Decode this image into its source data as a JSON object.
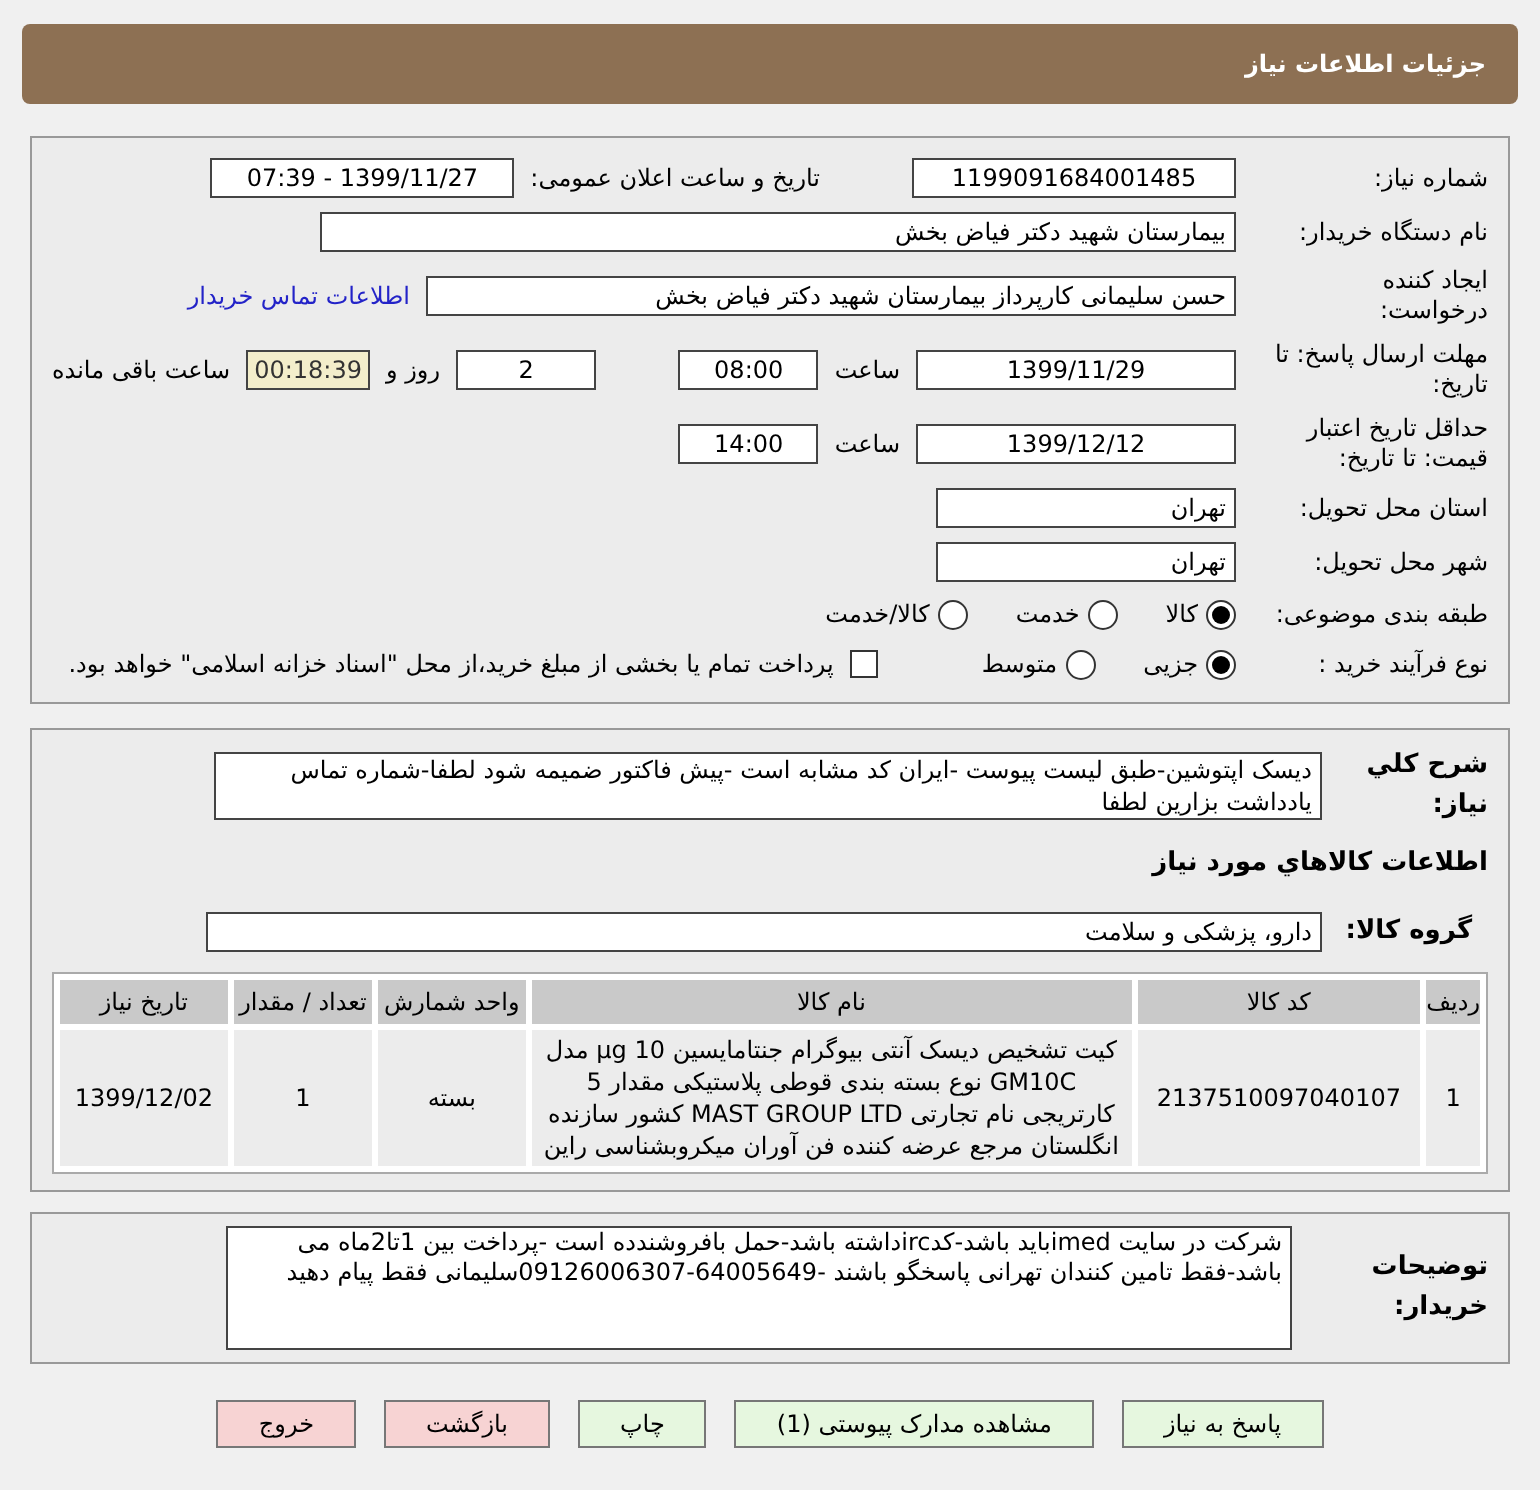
{
  "header": {
    "title": "جزئیات اطلاعات نیاز"
  },
  "details": {
    "need_number": {
      "label": "شماره نیاز:",
      "value": "1199091684001485"
    },
    "announce": {
      "label": "تاریخ و ساعت اعلان عمومی:",
      "value": "1399/11/27 - 07:39"
    },
    "buyer_org": {
      "label": "نام دستگاه خریدار:",
      "value": "بیمارستان شهید دکتر فیاض بخش"
    },
    "requester": {
      "label": "ایجاد کننده درخواست:",
      "value": "حسن سلیمانی کارپرداز بیمارستان شهید دکتر فیاض بخش",
      "link": "اطلاعات تماس خریدار"
    },
    "reply_deadline": {
      "label": "مهلت ارسال پاسخ: تا تاریخ:",
      "date": "1399/11/29",
      "time_label": "ساعت",
      "time": "08:00",
      "days": "2",
      "days_label": "روز و",
      "remaining": "00:18:39",
      "remaining_label": "ساعت باقی مانده"
    },
    "validity": {
      "label": "حداقل تاریخ اعتبار قیمت: تا تاریخ:",
      "date": "1399/12/12",
      "time_label": "ساعت",
      "time": "14:00"
    },
    "province": {
      "label": "استان محل تحویل:",
      "value": "تهران"
    },
    "city": {
      "label": "شهر محل تحویل:",
      "value": "تهران"
    },
    "category": {
      "label": "طبقه بندی موضوعی:",
      "options": [
        {
          "label": "کالا",
          "selected": true
        },
        {
          "label": "خدمت",
          "selected": false
        },
        {
          "label": "کالا/خدمت",
          "selected": false
        }
      ]
    },
    "process": {
      "label": "نوع فرآیند خرید :",
      "options": [
        {
          "label": "جزیی",
          "selected": true
        },
        {
          "label": "متوسط",
          "selected": false
        }
      ],
      "payment": {
        "checked": false,
        "label": "پرداخت تمام یا بخشی از مبلغ خرید،از محل \"اسناد خزانه اسلامی\" خواهد بود."
      }
    }
  },
  "description": {
    "label": "شرح کلي نياز:",
    "value": "دیسک اپتوشین-طبق لیست پیوست -ایران کد مشابه است -پیش فاکتور ضمیمه شود لطفا-شماره تماس یادداشت بزارین لطفا"
  },
  "goods_title": "اطلاعات کالاهاي مورد نياز",
  "group": {
    "label": "گروه کالا:",
    "value": "دارو، پزشکی و سلامت"
  },
  "table": {
    "columns": [
      "ردیف",
      "کد کالا",
      "نام کالا",
      "واحد شمارش",
      "تعداد / مقدار",
      "تاریخ نیاز"
    ],
    "rows": [
      [
        "1",
        "2137510097040107",
        "کیت تشخیص دیسک آنتی بیوگرام جنتامایسین 10 µg مدل GM10C نوع بسته بندی قوطی پلاستیکی مقدار 5 کارتریجی نام تجارتی MAST GROUP LTD کشور سازنده انگلستان مرجع عرضه کننده فن آوران میکروبشناسی راین",
        "بسته",
        "1",
        "1399/12/02"
      ]
    ]
  },
  "buyer_notes": {
    "label": "توضیحات خریدار:",
    "value": "شرکت در سایت imedباید باشد-کدircداشته باشد-حمل بافروشندده است -پرداخت بین 1تا2ماه می باشد-فقط تامین کنندان تهرانی پاسخگو باشند -64005649-09126006307سلیمانی فقط پیام دهید"
  },
  "buttons": [
    {
      "label": "پاسخ به نیاز",
      "kind": "green"
    },
    {
      "label": "مشاهده مدارک پیوستی (1)",
      "kind": "green"
    },
    {
      "label": "چاپ",
      "kind": "green"
    },
    {
      "label": "بازگشت",
      "kind": "red"
    },
    {
      "label": "خروج",
      "kind": "red"
    }
  ]
}
